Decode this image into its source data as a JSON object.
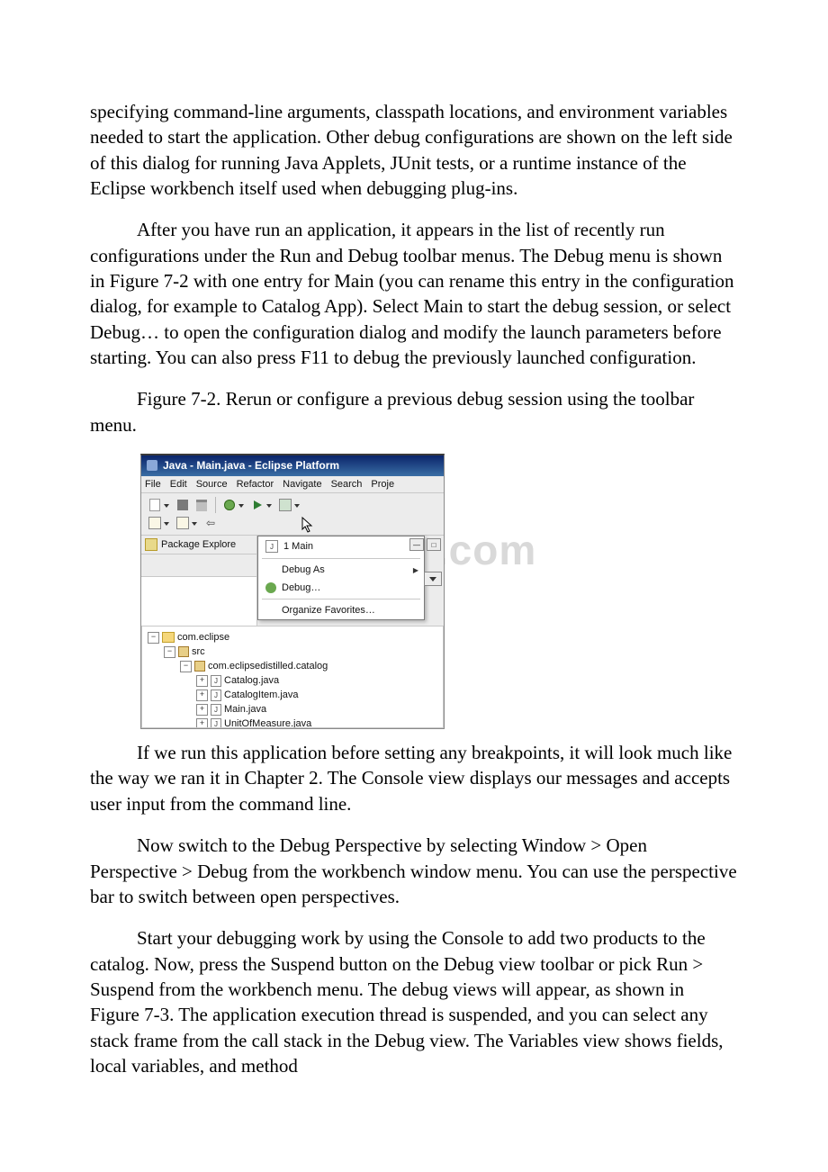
{
  "paragraphs": {
    "p1": "specifying command-line arguments, classpath locations, and environment variables needed to start the application. Other debug configurations are shown on the left side of this dialog for running Java Applets, JUnit tests, or a runtime instance of the Eclipse workbench itself used when debugging plug-ins.",
    "p2": "After you have run an application, it appears in the list of recently run configurations under the Run and Debug toolbar menus. The Debug menu is shown in Figure 7-2 with one entry for Main (you can rename this entry in the configuration dialog, for example to Catalog App). Select Main to start the debug session, or select Debug… to open the configuration dialog and modify the launch parameters before starting. You can also press F11 to debug the previously launched configuration.",
    "p3": "Figure 7-2. Rerun or configure a previous debug session using the toolbar menu.",
    "p4": "If we run this application before setting any breakpoints, it will look much like the way we ran it in Chapter 2. The Console view displays our messages and accepts user input from the command line.",
    "p5": "Now switch to the Debug Perspective by selecting Window > Open Perspective > Debug from the workbench window menu. You can use the perspective bar to switch between open perspectives.",
    "p6": "Start your debugging work by using the Console to add two products to the catalog. Now, press the Suspend button on the Debug view toolbar or pick Run > Suspend from the workbench menu. The debug views will appear, as shown in Figure 7-3. The application execution thread is suspended, and you can select any stack frame from the call stack in the Debug view. The Variables view shows fields, local variables, and method"
  },
  "watermark": "www.bdocx.com",
  "eclipse": {
    "title": "Java - Main.java - Eclipse Platform",
    "menubar": [
      "File",
      "Edit",
      "Source",
      "Refactor",
      "Navigate",
      "Search",
      "Proje"
    ],
    "explorer_title": "Package Explore",
    "dropdown": {
      "item1": "1 Main",
      "item2": "Debug As",
      "item3": "Debug…",
      "item4": "Organize Favorites…"
    },
    "tree": {
      "project": "com.eclipse",
      "src": "src",
      "package": "com.eclipsedistilled.catalog",
      "file1": "Catalog.java",
      "file2": "CatalogItem.java",
      "file3": "Main.java",
      "file4": "UnitOfMeasure.java"
    }
  }
}
